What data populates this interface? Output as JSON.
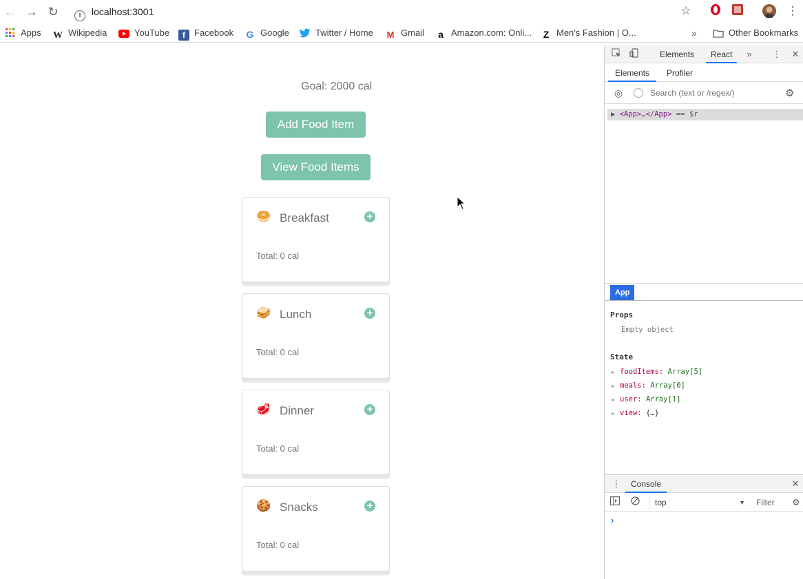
{
  "browser": {
    "url": "localhost:3001",
    "bookmarks": [
      "Apps",
      "Wikipedia",
      "YouTube",
      "Facebook",
      "Google",
      "Twitter / Home",
      "Gmail",
      "Amazon.com: Onli...",
      "Men's Fashion | O...",
      "Other Bookmarks"
    ]
  },
  "app": {
    "goal": "Goal: 2000 cal",
    "add_button": "Add Food Item",
    "view_button": "View Food Items",
    "meals": [
      {
        "name": "Breakfast",
        "emoji": "🥯",
        "total": "Total: 0 cal"
      },
      {
        "name": "Lunch",
        "emoji": "🥪",
        "total": "Total: 0 cal"
      },
      {
        "name": "Dinner",
        "emoji": "🥩",
        "total": "Total: 0 cal"
      },
      {
        "name": "Snacks",
        "emoji": "🍪",
        "total": "Total: 0 cal"
      }
    ]
  },
  "devtools": {
    "tabs": [
      "Elements",
      "React"
    ],
    "active_tab": "React",
    "react_subtabs": [
      "Elements",
      "Profiler"
    ],
    "search_placeholder": "Search (text or /regex/)",
    "tree_row": {
      "open": "<App>",
      "ellipsis": "…",
      "close": "</App>",
      "suffix": " == $r"
    },
    "selected_component": "App",
    "props_title": "Props",
    "props_value": "Empty object",
    "state_title": "State",
    "state": [
      {
        "key": "foodItems:",
        "value": "Array[5]"
      },
      {
        "key": "meals:",
        "value": "Array[0]"
      },
      {
        "key": "user:",
        "value": "Array[1]"
      },
      {
        "key": "view:",
        "value": "{…}"
      }
    ],
    "console_tab": "Console",
    "console_context": "top",
    "console_filter": "Filter",
    "console_prompt": "›"
  }
}
